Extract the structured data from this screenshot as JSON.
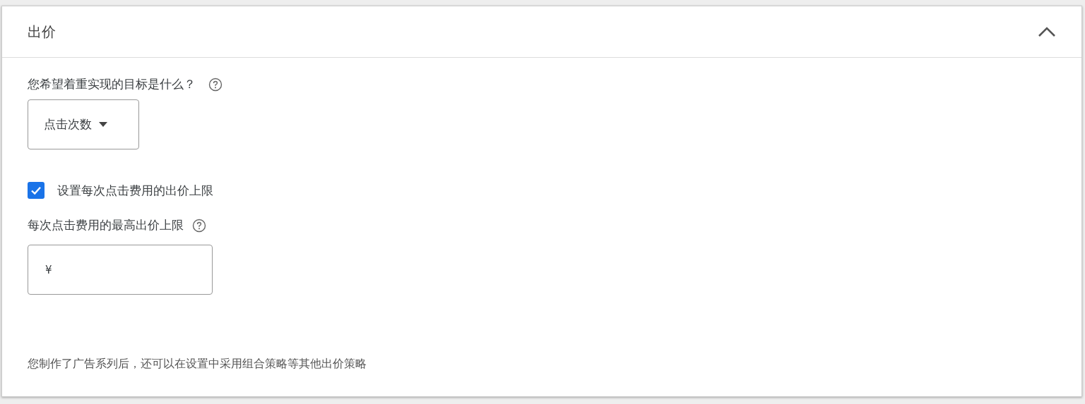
{
  "panel": {
    "title": "出价",
    "expanded": true
  },
  "goal": {
    "label": "您希望着重实现的目标是什么？",
    "dropdown": {
      "value": "点击次数"
    }
  },
  "cap_checkbox": {
    "label": "设置每次点击费用的出价上限",
    "checked": true
  },
  "max_bid": {
    "label": "每次点击费用的最高出价上限",
    "prefix": "¥"
  },
  "footer_note": "您制作了广告系列后，还可以在设置中采用组合策略等其他出价策略"
}
